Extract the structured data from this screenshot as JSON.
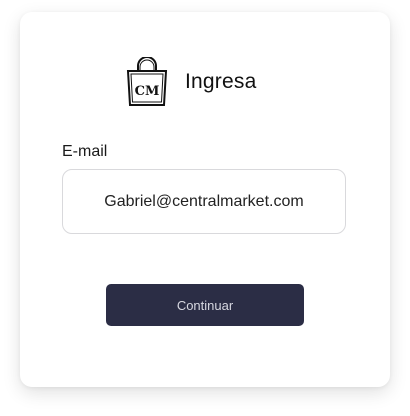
{
  "brand": {
    "logo_icon": "shopping-bag-cm-icon",
    "logo_text": "CM",
    "title": "Ingresa"
  },
  "form": {
    "email_label": "E-mail",
    "email_value": "Gabriel@centralmarket.com",
    "continue_label": "Continuar"
  },
  "colors": {
    "button_bg": "#2b2d45",
    "button_text": "#d6d7e0",
    "input_border": "#d9d9dc"
  }
}
